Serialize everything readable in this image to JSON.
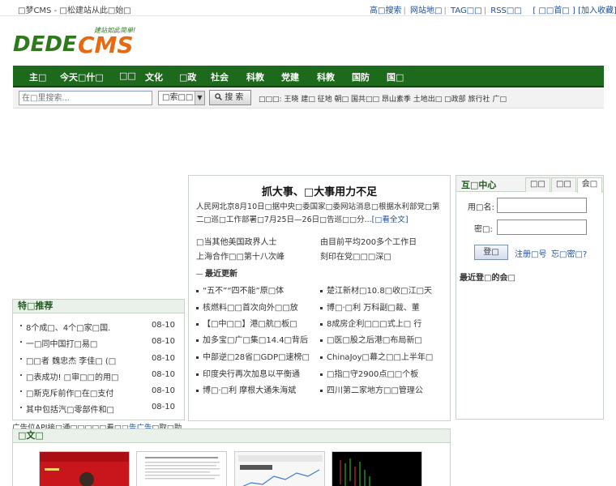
{
  "topbar": {
    "site_name": "□梦CMS - □松建站从此□始□",
    "links": [
      "高□搜索",
      "网站地□",
      "TAG□□",
      "RSS□□"
    ],
    "home_link": "[ □□首□ ]",
    "fav_link": "[加入收藏]"
  },
  "logo": {
    "text": "DEDECMS",
    "slogan": "建站如此简单!"
  },
  "nav": {
    "items": [
      "主□",
      "今天□什□",
      "□□",
      "文化",
      "□政",
      "社会",
      "科教",
      "党建",
      "科教",
      "国防",
      "国□"
    ]
  },
  "search": {
    "placeholder": "在□里搜索...",
    "type_label": "□索□□",
    "button_label": "搜 索",
    "hot_label": "□□□:",
    "hot_words": [
      "王晓",
      "建□",
      "征地",
      "朝□",
      "国共□□",
      "昂山素季",
      "土地出□",
      "□政部",
      "旅行社",
      "广□"
    ]
  },
  "recommend": {
    "title": "特□推荐",
    "items": [
      {
        "title": "8个成□、4个□家□国.",
        "date": "08-10"
      },
      {
        "title": "一□同中国打□易□",
        "date": "08-10"
      },
      {
        "title": "□□者 魏忠杰 李佳□ (□",
        "date": "08-10"
      },
      {
        "title": "□表成功! □审□□的用□",
        "date": "08-10"
      },
      {
        "title": "□斯克斥前作□在□支付",
        "date": "08-10"
      },
      {
        "title": "其中包括汽□零部件和□",
        "date": "08-10"
      }
    ]
  },
  "news": {
    "headline": "抓大事、□大事用力不足",
    "summary": "人民网北京8月10日□据中央□委国家□委网站消息□根据水利部党□第二□巡□工作部署□7月25日—26日□告巡□□分...",
    "more": "[□看全文]",
    "pairs": [
      "□当其他美国政界人士",
      "由目前平均200多个工作日",
      "上海合作□□第十八次峰",
      "刻印在党□□□深□"
    ],
    "latest_title": "最近更新",
    "latest": [
      "“五不”“四不能”原□体",
      "楚江新材□10.8□收□江□天",
      "核燃料□□首次向外□□放",
      "博□·□利 万科副□裁、董",
      "【□中□□】港□航□板□",
      "8成房企利□□□式上□ 行",
      "加多宝□广□集□14.4□背后",
      "□医□股之后港□布局新□",
      "中部逆□28省□GDP□速榜□",
      "ChinaJoy□幕之□□上半年□",
      "印度央行再次加息以平衡通",
      "□指□守2900点□□个板",
      "博□·□利 摩根大通朱海斌",
      "四川第二家地方□□管理公"
    ]
  },
  "member": {
    "title": "互□中心",
    "tabs": [
      "□□",
      "□□",
      "会□"
    ],
    "username_label": "用□名:",
    "password_label": "密□:",
    "login_button": "登□",
    "register_link": "注册□号",
    "forgot_link": "忘□密□?",
    "recent_title": "最近登□的会□"
  },
  "adline": {
    "text": "广告位API接□通□□□□□看□",
    "highlight": "□告广告",
    "tail": "□取□助"
  },
  "pictures": {
    "title": "□文□"
  },
  "colors": {
    "nav_green": "#1e6a1d",
    "link_blue": "#1f4f9c",
    "logo_green": "#2c7a1c",
    "logo_orange": "#e56a12"
  }
}
